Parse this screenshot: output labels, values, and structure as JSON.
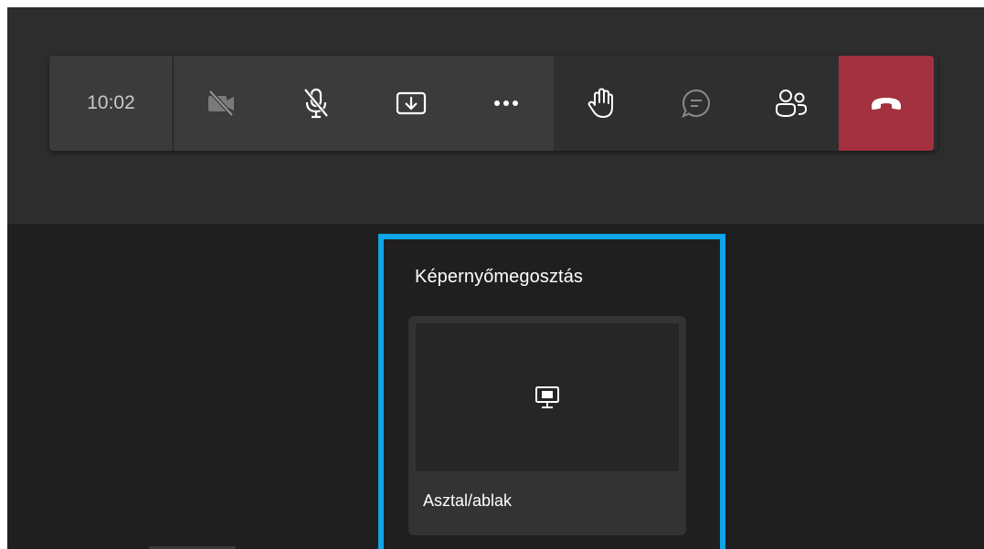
{
  "toolbar": {
    "timer": "10:02",
    "buttons": [
      {
        "name": "camera-off",
        "icon": "camera-off-icon"
      },
      {
        "name": "mic-off",
        "icon": "mic-off-icon"
      },
      {
        "name": "share",
        "icon": "share-tray-icon"
      },
      {
        "name": "more",
        "icon": "more-icon"
      },
      {
        "name": "raise-hand",
        "icon": "raise-hand-icon"
      },
      {
        "name": "chat",
        "icon": "chat-icon"
      },
      {
        "name": "participants",
        "icon": "people-icon"
      },
      {
        "name": "hang-up",
        "icon": "hang-up-icon"
      }
    ]
  },
  "share_panel": {
    "title": "Képernyőmegosztás",
    "options": [
      {
        "label": "Asztal/ablak",
        "icon": "monitor-icon"
      }
    ]
  },
  "colors": {
    "hangup": "#a4313f",
    "highlight": "#0ea5e9",
    "top_bg": "#2d2d2d",
    "main_bg": "#1f1f1f"
  }
}
